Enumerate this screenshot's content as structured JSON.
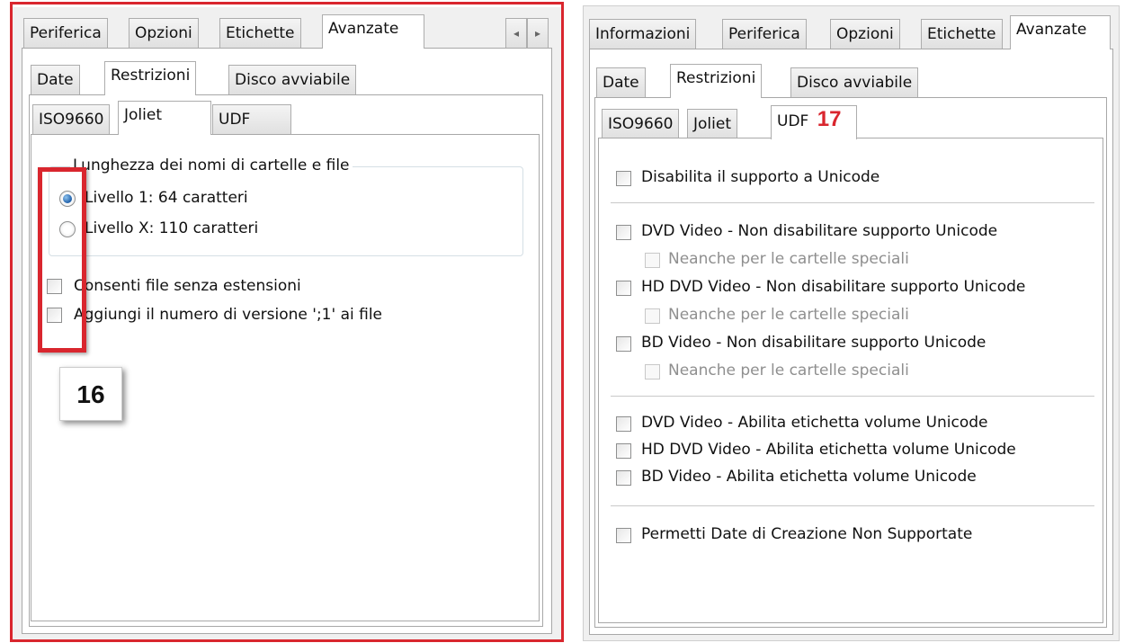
{
  "left": {
    "tabs": [
      "Periferica",
      "Opzioni",
      "Etichette",
      "Avanzate"
    ],
    "subtabs": [
      "Date",
      "Restrizioni",
      "Disco avviabile"
    ],
    "fstabs": [
      "ISO9660",
      "Joliet",
      "UDF"
    ],
    "group_title": "Lunghezza dei nomi di cartelle e file",
    "radio1": "Livello 1: 64 caratteri",
    "radio2": "Livello X: 110 caratteri",
    "check1": "Consenti file senza estensioni",
    "check2": "Aggiungi il numero di versione ';1' ai file",
    "callout": "16",
    "scroll_left": "◂",
    "scroll_right": "▸"
  },
  "right": {
    "tabs": [
      "Informazioni",
      "Periferica",
      "Opzioni",
      "Etichette",
      "Avanzate"
    ],
    "subtabs": [
      "Date",
      "Restrizioni",
      "Disco avviabile"
    ],
    "fstabs": [
      "ISO9660",
      "Joliet",
      "UDF"
    ],
    "callout": "17",
    "opt_unicode": "Disabilita il supporto a Unicode",
    "opt_dvd": "DVD Video - Non disabilitare supporto Unicode",
    "opt_dvd_sub": "Neanche per le cartelle speciali",
    "opt_hddvd": "HD DVD Video - Non disabilitare supporto Unicode",
    "opt_hddvd_sub": "Neanche per le cartelle speciali",
    "opt_bd": "BD Video - Non disabilitare supporto Unicode",
    "opt_bd_sub": "Neanche per le cartelle speciali",
    "opt_dvd_label": "DVD Video - Abilita etichetta volume Unicode",
    "opt_hddvd_label": "HD DVD Video - Abilita etichetta volume Unicode",
    "opt_bd_label": "BD Video - Abilita etichetta volume Unicode",
    "opt_dates": "Permetti Date di Creazione Non Supportate"
  },
  "colors": {
    "highlight": "#d9262e",
    "callout_red": "#d9262e"
  }
}
